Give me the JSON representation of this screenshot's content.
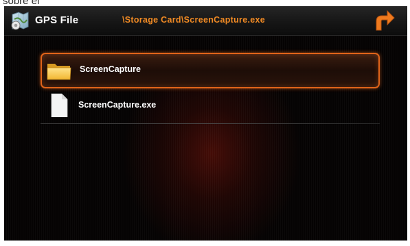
{
  "caption_fragment": "sobre él",
  "header": {
    "app_title": "GPS File",
    "path": "\\Storage Card\\ScreenCapture.exe",
    "back_icon": "back-arrow-icon"
  },
  "files": [
    {
      "name": "ScreenCapture",
      "type": "folder",
      "icon": "folder-icon",
      "selected": true
    },
    {
      "name": "ScreenCapture.exe",
      "type": "file",
      "icon": "file-icon",
      "selected": false
    }
  ],
  "colors": {
    "accent": "#f08a24",
    "selection_border": "#e0641a",
    "background": "#050303"
  }
}
